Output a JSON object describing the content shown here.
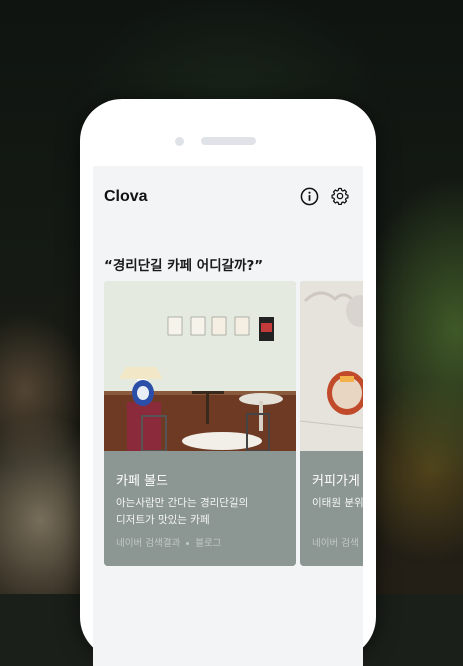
{
  "app": {
    "title": "Clova",
    "icons": {
      "info": "info-circle-icon",
      "settings": "gear-icon"
    }
  },
  "query": "“경리단길 카페 어디갈까?”",
  "cards": [
    {
      "title": "카페 볼드",
      "description_line1": "아는사람만 간다는 경리단길의",
      "description_line2": "디저트가 맛있는 카페",
      "source": "네이버 검색결과",
      "category": "블로그"
    },
    {
      "title": "커피가게",
      "description_line1": "이태원 분위",
      "source": "네이버 검색"
    }
  ],
  "colors": {
    "card_info_bg": "#8c9692",
    "screen_bg": "#f2f4f6"
  }
}
